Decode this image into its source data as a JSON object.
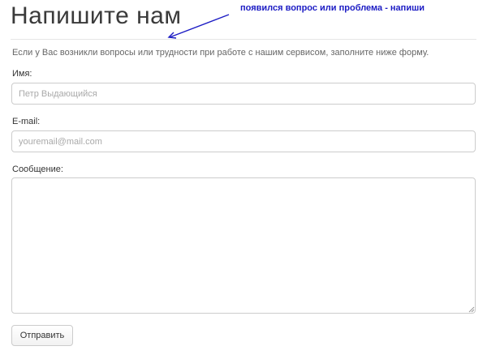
{
  "header": {
    "title": "Напишите нам"
  },
  "annotation": {
    "text": "появился вопрос или проблема - напиши",
    "color": "#1c1cc4"
  },
  "intro": {
    "text": "Если у Вас возникли вопросы или трудности при работе с нашим сервисом, заполните ниже форму."
  },
  "form": {
    "name": {
      "label": "Имя:",
      "value": "",
      "placeholder": "Петр Выдающийся"
    },
    "email": {
      "label": "E-mail:",
      "value": "",
      "placeholder": "youremail@mail.com"
    },
    "message": {
      "label": "Сообщение:",
      "value": ""
    },
    "submit_label": "Отправить"
  },
  "icons": {
    "annotation_arrow": "arrow-icon",
    "textarea_grip": "resize-grip-icon"
  }
}
